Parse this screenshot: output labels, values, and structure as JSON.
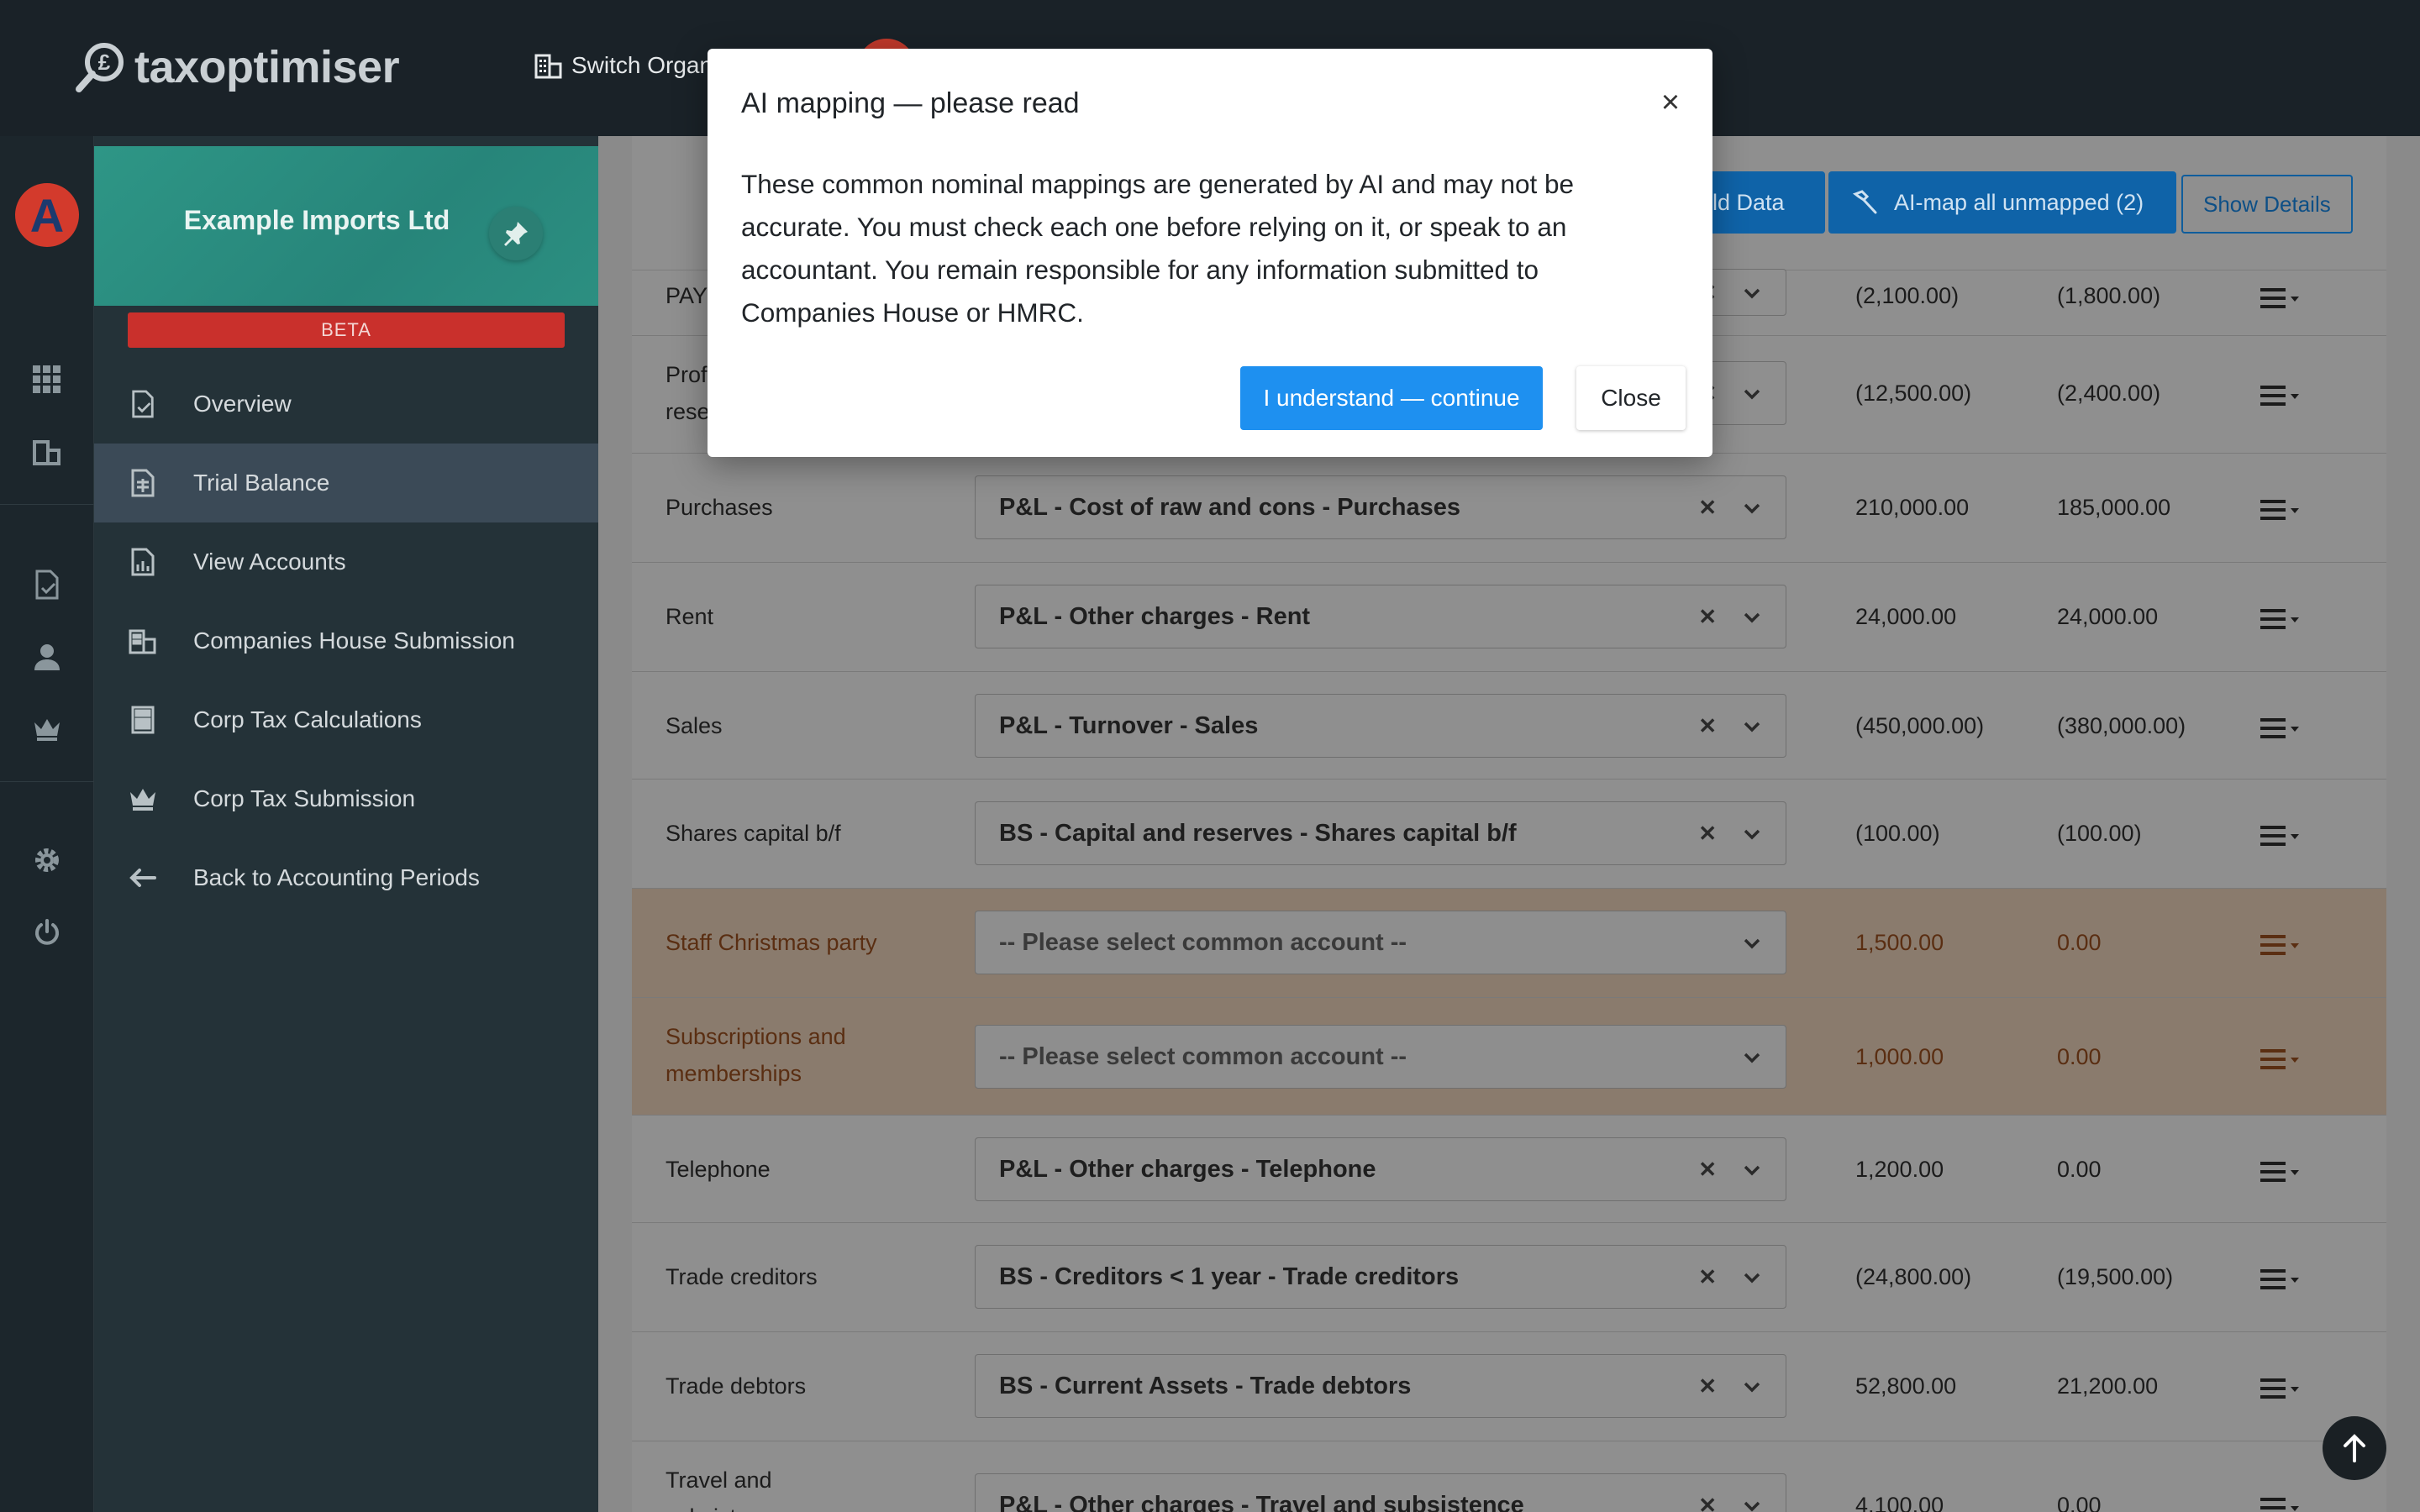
{
  "header": {
    "logo_text": "taxoptimiser",
    "switch_org_label": "Switch Organ"
  },
  "rail": {
    "avatar_letter": "A"
  },
  "sidebar": {
    "org_name": "Example Imports Ltd",
    "beta_label": "BETA",
    "items": [
      {
        "label": "Overview",
        "icon": "document-check-icon"
      },
      {
        "label": "Trial Balance",
        "icon": "spreadsheet-icon"
      },
      {
        "label": "View Accounts",
        "icon": "report-icon"
      },
      {
        "label": "Companies House Submission",
        "icon": "building-icon"
      },
      {
        "label": "Corp Tax Calculations",
        "icon": "calculator-icon"
      },
      {
        "label": "Corp Tax Submission",
        "icon": "crown-icon"
      },
      {
        "label": "Back to Accounting Periods",
        "icon": "arrow-left-icon"
      }
    ]
  },
  "toolbar": {
    "build_data_label": "ild Data",
    "ai_map_label": "AI-map all unmapped (2)",
    "show_details_label": "Show Details"
  },
  "rows": [
    {
      "name": "PAY",
      "mapping": "",
      "v1": "(2,100.00)",
      "v2": "(1,800.00)"
    },
    {
      "name": "Prof\nrese",
      "mapping": "",
      "v1": "(12,500.00)",
      "v2": "(2,400.00)"
    },
    {
      "name": "Purchases",
      "mapping": "P&L - Cost of raw and cons - Purchases",
      "v1": "210,000.00",
      "v2": "185,000.00"
    },
    {
      "name": "Rent",
      "mapping": "P&L - Other charges - Rent",
      "v1": "24,000.00",
      "v2": "24,000.00"
    },
    {
      "name": "Sales",
      "mapping": "P&L - Turnover - Sales",
      "v1": "(450,000.00)",
      "v2": "(380,000.00)"
    },
    {
      "name": "Shares capital b/f",
      "mapping": "BS - Capital and reserves - Shares capital b/f",
      "v1": "(100.00)",
      "v2": "(100.00)"
    },
    {
      "name": "Staff Christmas party",
      "mapping": "-- Please select common account --",
      "v1": "1,500.00",
      "v2": "0.00"
    },
    {
      "name": "Subscriptions and memberships",
      "mapping": "-- Please select common account --",
      "v1": "1,000.00",
      "v2": "0.00"
    },
    {
      "name": "Telephone",
      "mapping": "P&L - Other charges - Telephone",
      "v1": "1,200.00",
      "v2": "0.00"
    },
    {
      "name": "Trade creditors",
      "mapping": "BS - Creditors < 1 year - Trade creditors",
      "v1": "(24,800.00)",
      "v2": "(19,500.00)"
    },
    {
      "name": "Trade debtors",
      "mapping": "BS - Current Assets - Trade debtors",
      "v1": "52,800.00",
      "v2": "21,200.00"
    },
    {
      "name": "Travel and subsistence",
      "mapping": "P&L - Other charges - Travel and subsistence",
      "v1": "4,100.00",
      "v2": "0.00"
    }
  ],
  "modal": {
    "title": "AI mapping — please read",
    "close_glyph": "×",
    "body": "These common nominal mappings are generated by AI and may not be accurate. You must check each one before relying on it, or speak to an accountant. You remain responsible for any information submitted to Companies House or HMRC.",
    "confirm_label": "I understand — continue",
    "close_label": "Close"
  },
  "colors": {
    "accent": "#1e90f0",
    "unmapped_row": "#8a7b6d",
    "beta": "#c9302c",
    "org_header": "#2a8f82"
  }
}
